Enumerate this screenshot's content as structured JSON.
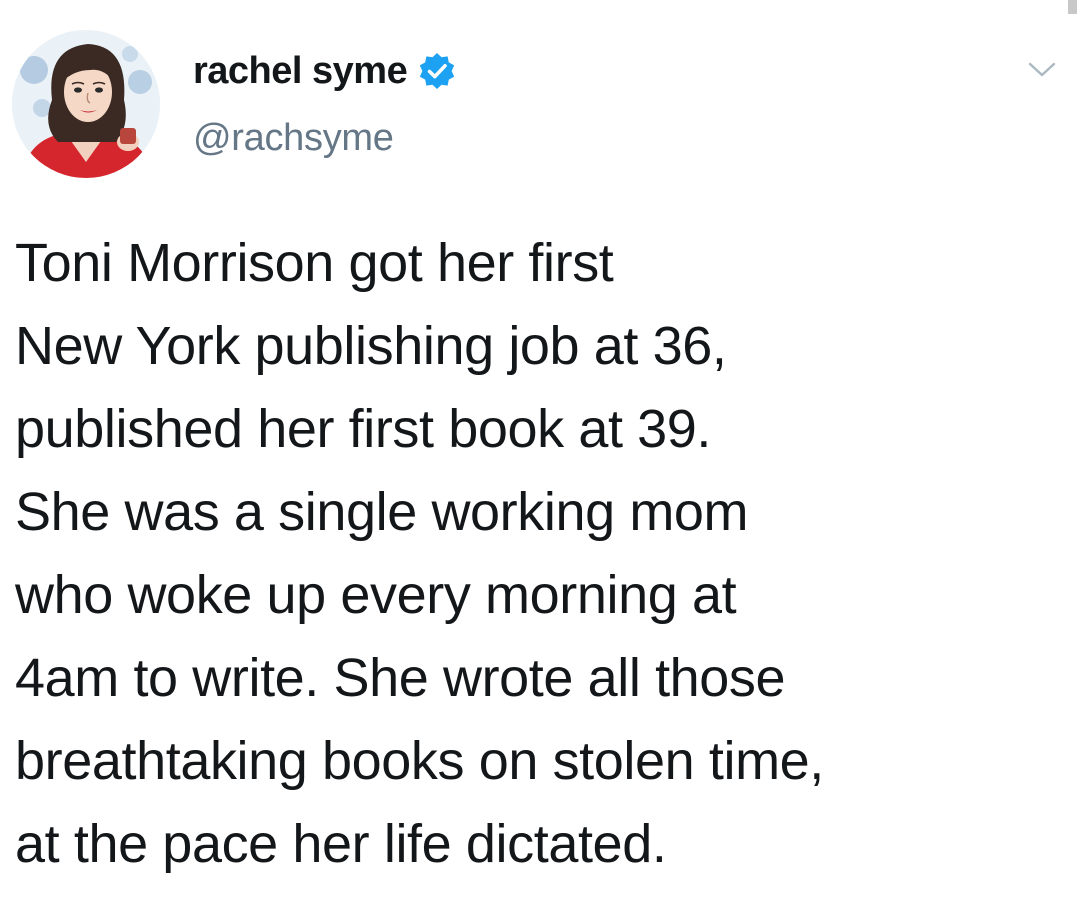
{
  "tweet": {
    "author": {
      "display_name": "rachel syme",
      "handle": "@rachsyme",
      "verified": true,
      "verified_color": "#1da1f2"
    },
    "text_lines": [
      "Toni Morrison got her first",
      "New York publishing job at 36,",
      "published her first book at 39.",
      "She was a single working mom",
      "who woke up every morning at",
      "4am to write. She wrote all those",
      "breathtaking books on stolen time,",
      "at the pace her life dictated."
    ],
    "menu_icon": "chevron-down-icon",
    "avatar_icon": "illustrated-portrait"
  },
  "colors": {
    "text": "#14171a",
    "handle": "#657786",
    "background": "#ffffff"
  }
}
